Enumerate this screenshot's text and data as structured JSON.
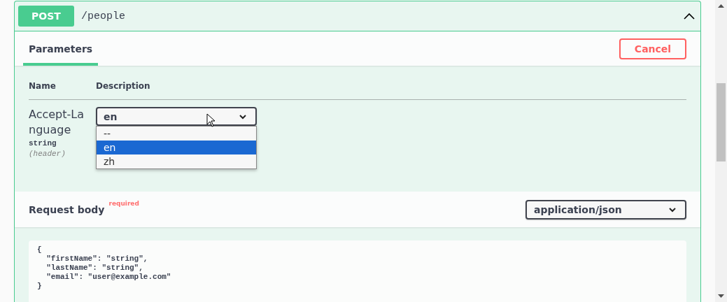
{
  "operation": {
    "method": "POST",
    "path": "/people",
    "expanded": true
  },
  "tabs": [
    {
      "label": "Parameters",
      "selected": true
    }
  ],
  "cancel_button": "Cancel",
  "parameters": {
    "columns": [
      "Name",
      "Description"
    ],
    "rows": [
      {
        "name": "Accept-Language",
        "type": "string",
        "location": "(header)",
        "value": "en",
        "open": true,
        "options": [
          {
            "label": "--",
            "selected": false
          },
          {
            "label": "en",
            "selected": true
          },
          {
            "label": "zh",
            "selected": false
          }
        ]
      }
    ]
  },
  "request_body": {
    "title": "Request body",
    "required": "required",
    "content_type": "application/json",
    "example": "{\n  \"firstName\": \"string\",\n  \"lastName\": \"string\",\n  \"email\": \"user@example.com\"\n}"
  }
}
